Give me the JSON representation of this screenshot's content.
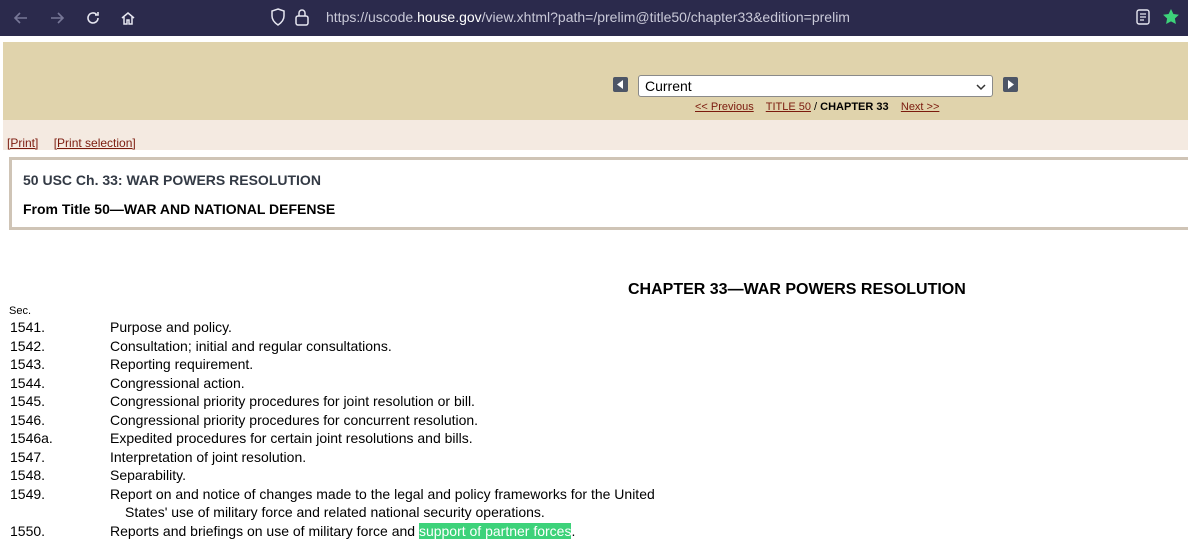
{
  "browser": {
    "url_prefix": "https://uscode.",
    "url_host": "house.gov",
    "url_path": "/view.xhtml?path=/prelim@title50/chapter33&edition=prelim",
    "icons": [
      "back-arrow-icon",
      "forward-arrow-icon",
      "reload-icon",
      "home-icon",
      "shield-icon",
      "lock-icon",
      "reader-view-icon",
      "bookmark-star-icon"
    ]
  },
  "edition_nav": {
    "selected": "Current",
    "previous": "<< Previous",
    "title_link": "TITLE 50",
    "separator": "/",
    "chapter": "CHAPTER 33",
    "next": "Next >>"
  },
  "print_links": {
    "print": "[Print]",
    "print_selection": "[Print selection]"
  },
  "header": {
    "citation": "50 USC Ch. 33: WAR POWERS RESOLUTION",
    "from_title": "From Title 50—WAR AND NATIONAL DEFENSE"
  },
  "chapter": {
    "title": "CHAPTER 33—WAR POWERS RESOLUTION",
    "sec_label": "Sec.",
    "sections": [
      {
        "num": "1541.",
        "title": "Purpose and policy."
      },
      {
        "num": "1542.",
        "title": "Consultation; initial and regular consultations."
      },
      {
        "num": "1543.",
        "title": "Reporting requirement."
      },
      {
        "num": "1544.",
        "title": "Congressional action."
      },
      {
        "num": "1545.",
        "title": "Congressional priority procedures for joint resolution or bill."
      },
      {
        "num": "1546.",
        "title": "Congressional priority procedures for concurrent resolution."
      },
      {
        "num": "1546a.",
        "title": "Expedited procedures for certain joint resolutions and bills."
      },
      {
        "num": "1547.",
        "title": "Interpretation of joint resolution."
      },
      {
        "num": "1548.",
        "title": "Separability."
      },
      {
        "num": "1549.",
        "title": "Report on and notice of changes made to the legal and policy frameworks for the United",
        "title_cont": "States' use of military force and related national security operations."
      },
      {
        "num": "1550.",
        "title": "Reports and briefings on use of military force and ",
        "highlight": "support of partner forces",
        "title_end": "."
      }
    ]
  },
  "colors": {
    "chrome_bg": "#2b2a4c",
    "top_band": "#e0d3ac",
    "print_band": "#f4eae1",
    "link": "#7b1b0e",
    "highlight": "#3dd27a"
  }
}
